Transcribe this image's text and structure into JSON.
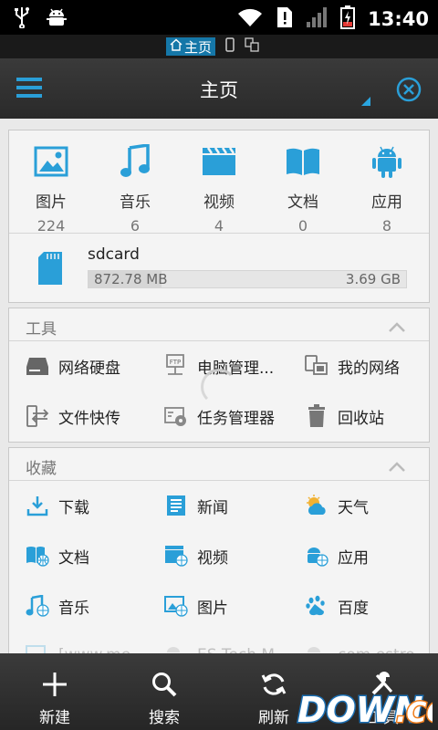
{
  "status_bar": {
    "time": "13:40"
  },
  "tab_strip": {
    "active_tab": "主页"
  },
  "title_bar": {
    "title": "主页"
  },
  "categories": [
    {
      "label": "图片",
      "count": "224",
      "icon": "image-icon"
    },
    {
      "label": "音乐",
      "count": "6",
      "icon": "music-icon"
    },
    {
      "label": "视频",
      "count": "4",
      "icon": "video-icon"
    },
    {
      "label": "文档",
      "count": "0",
      "icon": "book-icon"
    },
    {
      "label": "应用",
      "count": "8",
      "icon": "android-icon"
    }
  ],
  "sdcard": {
    "name": "sdcard",
    "used": "872.78 MB",
    "total": "3.69 GB",
    "used_fraction": 0.23
  },
  "tools": {
    "header": "工具",
    "items": [
      {
        "label": "网络硬盘",
        "icon": "cloud-drive-icon"
      },
      {
        "label": "电脑管理...",
        "icon": "ftp-icon"
      },
      {
        "label": "我的网络",
        "icon": "network-icon"
      },
      {
        "label": "文件快传",
        "icon": "file-transfer-icon"
      },
      {
        "label": "任务管理器",
        "icon": "task-manager-icon"
      },
      {
        "label": "回收站",
        "icon": "trash-icon"
      }
    ]
  },
  "favorites": {
    "header": "收藏",
    "items": [
      {
        "label": "下载",
        "icon": "download-icon"
      },
      {
        "label": "新闻",
        "icon": "news-icon"
      },
      {
        "label": "天气",
        "icon": "weather-icon"
      },
      {
        "label": "文档",
        "icon": "book-web-icon"
      },
      {
        "label": "视频",
        "icon": "video-web-icon"
      },
      {
        "label": "应用",
        "icon": "android-web-icon"
      },
      {
        "label": "音乐",
        "icon": "music-web-icon"
      },
      {
        "label": "图片",
        "icon": "image-web-icon"
      },
      {
        "label": "百度",
        "icon": "baidu-icon"
      },
      {
        "label": "[www.me",
        "icon": "web-image-icon"
      },
      {
        "label": "ES Tech M",
        "icon": "android-web-icon"
      },
      {
        "label": "com.estro",
        "icon": "android-web-icon"
      }
    ]
  },
  "toolbar": {
    "buttons": [
      {
        "label": "新建",
        "icon": "plus-icon"
      },
      {
        "label": "搜索",
        "icon": "search-icon"
      },
      {
        "label": "刷新",
        "icon": "refresh-icon"
      },
      {
        "label": "工具",
        "icon": "wrench-icon"
      }
    ]
  },
  "watermark": {
    "text": "DOWN.CC"
  },
  "colors": {
    "accent": "#2a9fd8",
    "bar": "#2e2e2e",
    "panel": "#f4f4f4"
  }
}
